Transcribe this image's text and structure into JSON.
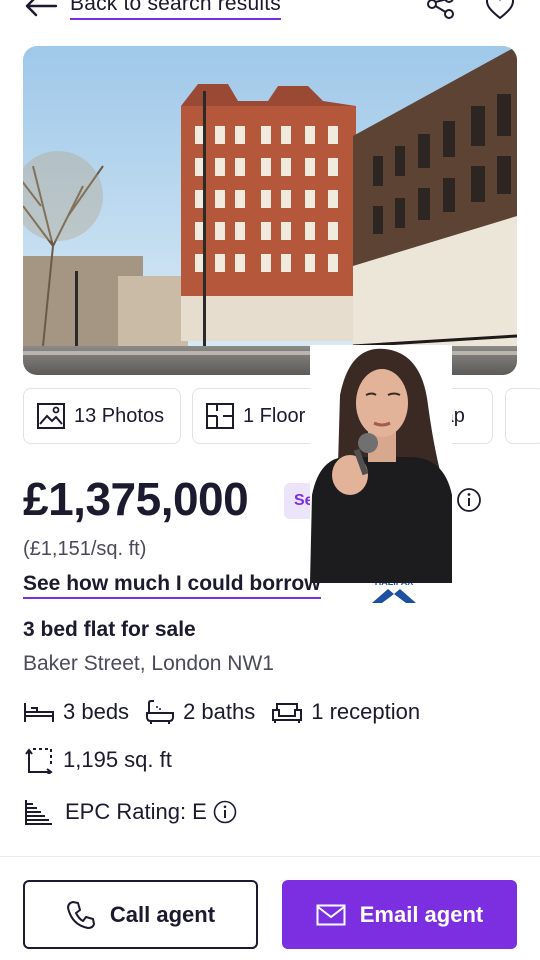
{
  "header": {
    "back_label": "Back to search results",
    "icons": [
      "back-arrow-icon",
      "share-icon",
      "heart-icon"
    ]
  },
  "hero": {
    "image": "street-view-brick-mansion-block"
  },
  "media_tabs": [
    {
      "label": "13 Photos",
      "icon": "photos-icon"
    },
    {
      "label": "1 Floor plan",
      "icon": "floorplan-icon"
    },
    {
      "label": "Map",
      "icon": "map-icon"
    }
  ],
  "listing": {
    "price": "£1,375,000",
    "badge": "Se",
    "price_per_sqft": "(£1,151/sq. ft)",
    "borrow_link": "See how much I could borrow",
    "lender_logo": "HALIFAX",
    "title": "3 bed flat for sale",
    "address": "Baker Street, London NW1",
    "beds": "3 beds",
    "baths": "2 baths",
    "receptions": "1 reception",
    "area": "1,195 sq. ft",
    "epc": "EPC Rating: E"
  },
  "actions": {
    "call_label": "Call agent",
    "email_label": "Email agent"
  },
  "colors": {
    "accent": "#7b2fe0",
    "text": "#1b1a2e",
    "muted": "#4a4a5a"
  }
}
